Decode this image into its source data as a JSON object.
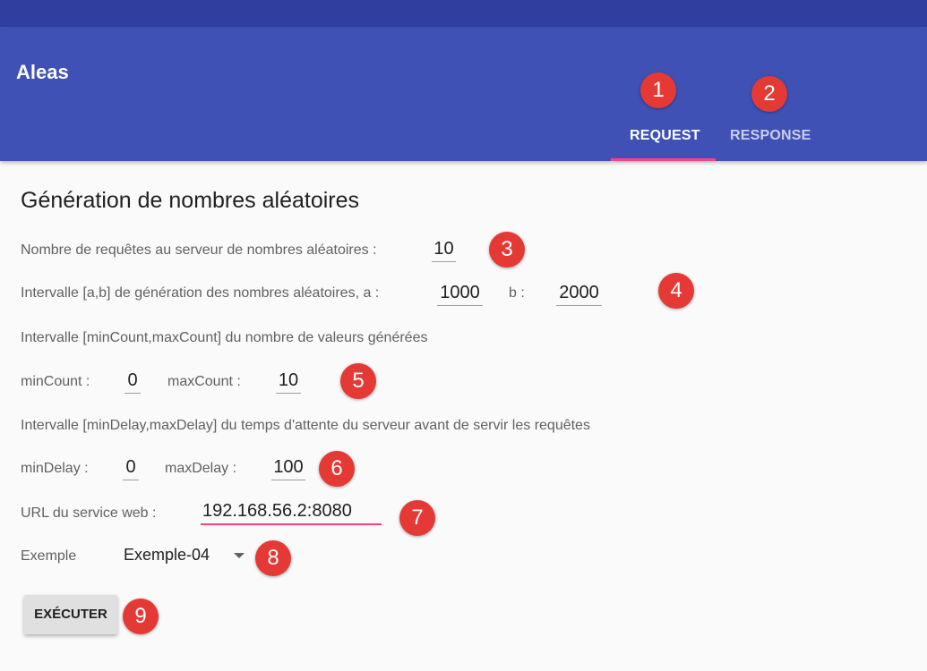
{
  "app": {
    "title": "Aleas"
  },
  "tabs": [
    {
      "label": "REQUEST",
      "active": true
    },
    {
      "label": "RESPONSE",
      "active": false
    }
  ],
  "form": {
    "heading": "Génération de nombres aléatoires",
    "requests_label": "Nombre de requêtes au serveur de nombres aléatoires :",
    "requests_value": "10",
    "interval_label": "Intervalle [a,b] de génération des nombres aléatoires, a :",
    "a_value": "1000",
    "b_label": "b :",
    "b_value": "2000",
    "count_section_label": "Intervalle [minCount,maxCount] du nombre de valeurs générées",
    "min_count_label": "minCount :",
    "min_count_value": "0",
    "max_count_label": "maxCount :",
    "max_count_value": "10",
    "delay_section_label": "Intervalle [minDelay,maxDelay] du temps d'attente du serveur avant de servir les requêtes",
    "min_delay_label": "minDelay :",
    "min_delay_value": "0",
    "max_delay_label": "maxDelay :",
    "max_delay_value": "100",
    "url_label": "URL du service web :",
    "url_value": "192.168.56.2:8080",
    "example_label": "Exemple",
    "example_value": "Exemple-04",
    "execute_label": "EXÉCUTER"
  },
  "annotations": [
    "1",
    "2",
    "3",
    "4",
    "5",
    "6",
    "7",
    "8",
    "9"
  ],
  "colors": {
    "primary": "#3f51b5",
    "primary_dark": "#303f9f",
    "accent": "#ff4081",
    "badge": "#e53935"
  }
}
